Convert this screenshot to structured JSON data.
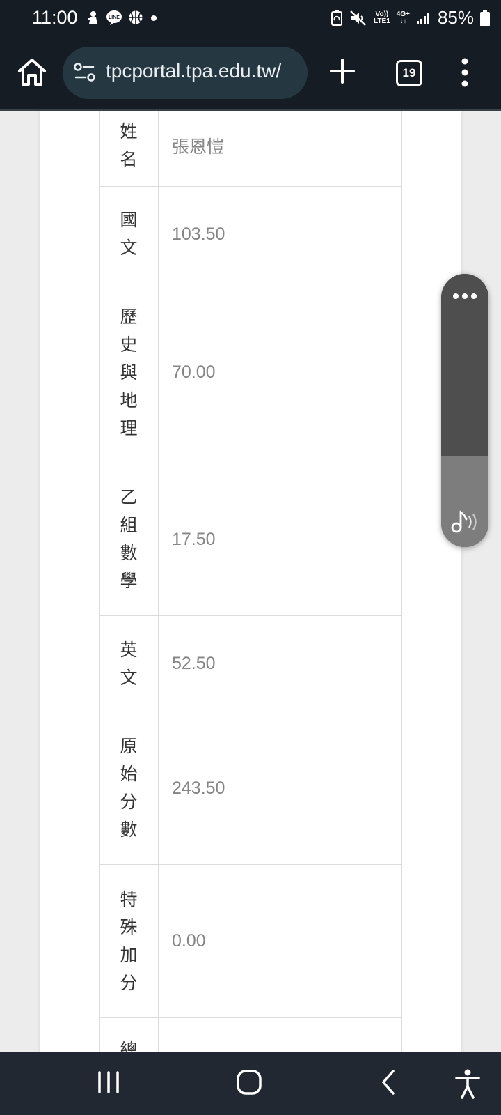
{
  "status_bar": {
    "time": "11:00",
    "notification_icons": [
      "game-icon",
      "line-icon",
      "basketball-icon",
      "dot-icon"
    ],
    "volte_line1": "Vo))",
    "volte_line2": "LTE1",
    "network": "4G+",
    "battery_percent": "85%"
  },
  "browser": {
    "url": "tpcportal.tpa.edu.tw/",
    "tab_count": "19"
  },
  "score_table": {
    "rows": [
      {
        "label": "姓名",
        "value": "張恩愷"
      },
      {
        "label": "國文",
        "value": "103.50"
      },
      {
        "label": "歷史與地理",
        "value": "70.00"
      },
      {
        "label": "乙組數學",
        "value": "17.50"
      },
      {
        "label": "英文",
        "value": "52.50"
      },
      {
        "label": "原始分數",
        "value": "243.50"
      },
      {
        "label": "特殊加分",
        "value": "0.00"
      },
      {
        "label": "總",
        "value": ""
      }
    ]
  },
  "floating_panel": {
    "icons": [
      "more-dots-icon",
      "sound-note-icon"
    ]
  },
  "nav_bar": {
    "icons": [
      "recents-icon",
      "home-icon",
      "back-icon",
      "accessibility-icon"
    ]
  },
  "colors": {
    "system_bar": "#151c24",
    "url_bar": "#253841",
    "label_text": "#333333",
    "value_text": "#858585"
  }
}
